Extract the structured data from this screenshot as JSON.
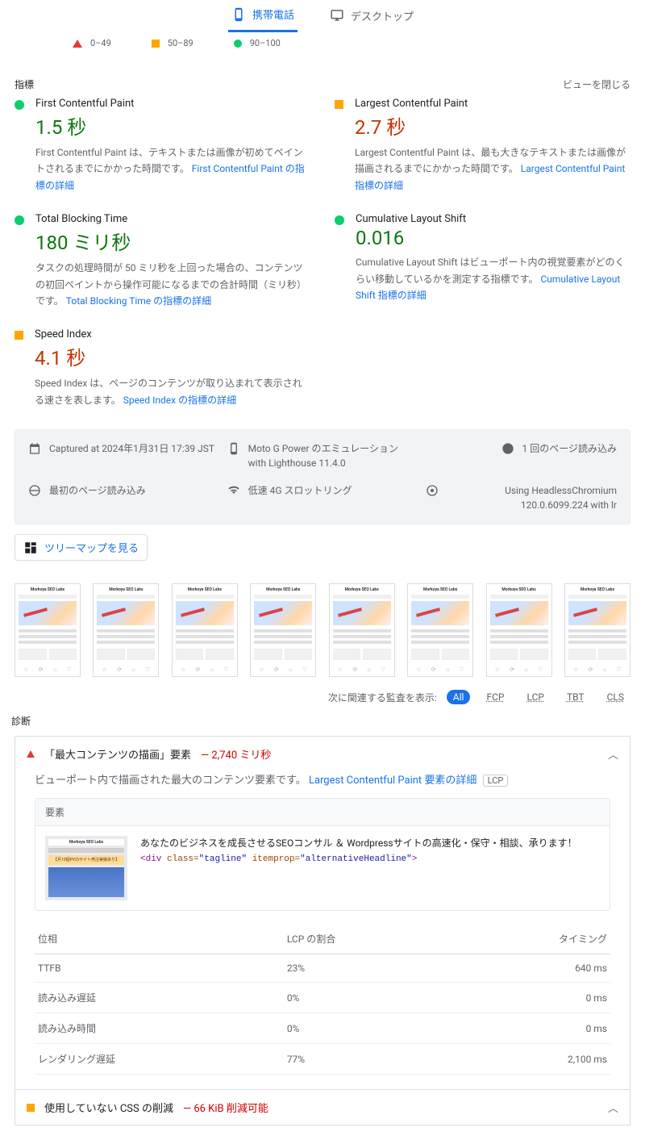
{
  "tabs": {
    "mobile": "携帯電話",
    "desktop": "デスクトップ"
  },
  "legend": {
    "r1": "0–49",
    "r2": "50–89",
    "r3": "90–100"
  },
  "metricsHeader": {
    "label": "指標",
    "close": "ビューを閉じる"
  },
  "metrics": {
    "fcp": {
      "name": "First Contentful Paint",
      "value": "1.5 秒",
      "desc": "First Contentful Paint は、テキストまたは画像が初めてペイントされるまでにかかった時間です。",
      "link": "First Contentful Paint の指標の詳細"
    },
    "lcp": {
      "name": "Largest Contentful Paint",
      "value": "2.7 秒",
      "desc": "Largest Contentful Paint は、最も大きなテキストまたは画像が描画されるまでにかかった時間です。",
      "link": "Largest Contentful Paint 指標の詳細"
    },
    "tbt": {
      "name": "Total Blocking Time",
      "value": "180 ミリ秒",
      "desc": "タスクの処理時間が 50 ミリ秒を上回った場合の、コンテンツの初回ペイントから操作可能になるまでの合計時間（ミリ秒）です。",
      "link": "Total Blocking Time の指標の詳細"
    },
    "cls": {
      "name": "Cumulative Layout Shift",
      "value": "0.016",
      "desc": "Cumulative Layout Shift はビューポート内の視覚要素がどのくらい移動しているかを測定する指標です。",
      "link": "Cumulative Layout Shift 指標の詳細"
    },
    "si": {
      "name": "Speed Index",
      "value": "4.1 秒",
      "desc": "Speed Index は、ページのコンテンツが取り込まれて表示される速さを表します。",
      "link": "Speed Index の指標の詳細"
    }
  },
  "env": {
    "captured": "Captured at 2024年1月31日 17:39 JST",
    "device": "Moto G Power のエミュレーション with Lighthouse 11.4.0",
    "load": "1 回のページ読み込み",
    "initial": "最初のページ読み込み",
    "throttle": "低速 4G スロットリング",
    "browser": "Using HeadlessChromium 120.0.6099.224 with lr"
  },
  "treemap": "ツリーマップを見る",
  "filters": {
    "label": "次に関連する監査を表示:",
    "all": "All",
    "fcp": "FCP",
    "lcp": "LCP",
    "tbt": "TBT",
    "cls": "CLS"
  },
  "diagTitle": "診断",
  "audits": {
    "lcp": {
      "title": "「最大コンテンツの描画」要素",
      "value": "— 2,740 ミリ秒",
      "intro": "ビューポート内で描画された最大のコンテンツ要素です。",
      "link": "Largest Contentful Paint 要素の詳細",
      "tag": "LCP",
      "elemHead": "要素",
      "elemText": "あなたのビジネスを成長させるSEOコンサル ＆ Wordpressサイトの高速化・保守・相談、承ります！",
      "thumb_title": "Morkoya SEO Labs",
      "thumb_sub": "【月10個PVのサイト売注実績あり】",
      "code_tag": "div",
      "code_attr1_name": "class",
      "code_attr1_val": "tagline",
      "code_attr2_name": "itemprop",
      "code_attr2_val": "alternativeHeadline",
      "tableHead": {
        "phase": "位相",
        "pct": "LCP の割合",
        "timing": "タイミング"
      },
      "rows": [
        {
          "phase": "TTFB",
          "pct": "23%",
          "timing": "640 ms"
        },
        {
          "phase": "読み込み遅延",
          "pct": "0%",
          "timing": "0 ms"
        },
        {
          "phase": "読み込み時間",
          "pct": "0%",
          "timing": "0 ms"
        },
        {
          "phase": "レンダリング遅延",
          "pct": "77%",
          "timing": "2,100 ms"
        }
      ]
    },
    "css": {
      "title": "使用していない CSS の削減",
      "value": "— 66 KiB 削減可能"
    }
  },
  "frame": {
    "title": "Morkoya SEO Labs"
  }
}
